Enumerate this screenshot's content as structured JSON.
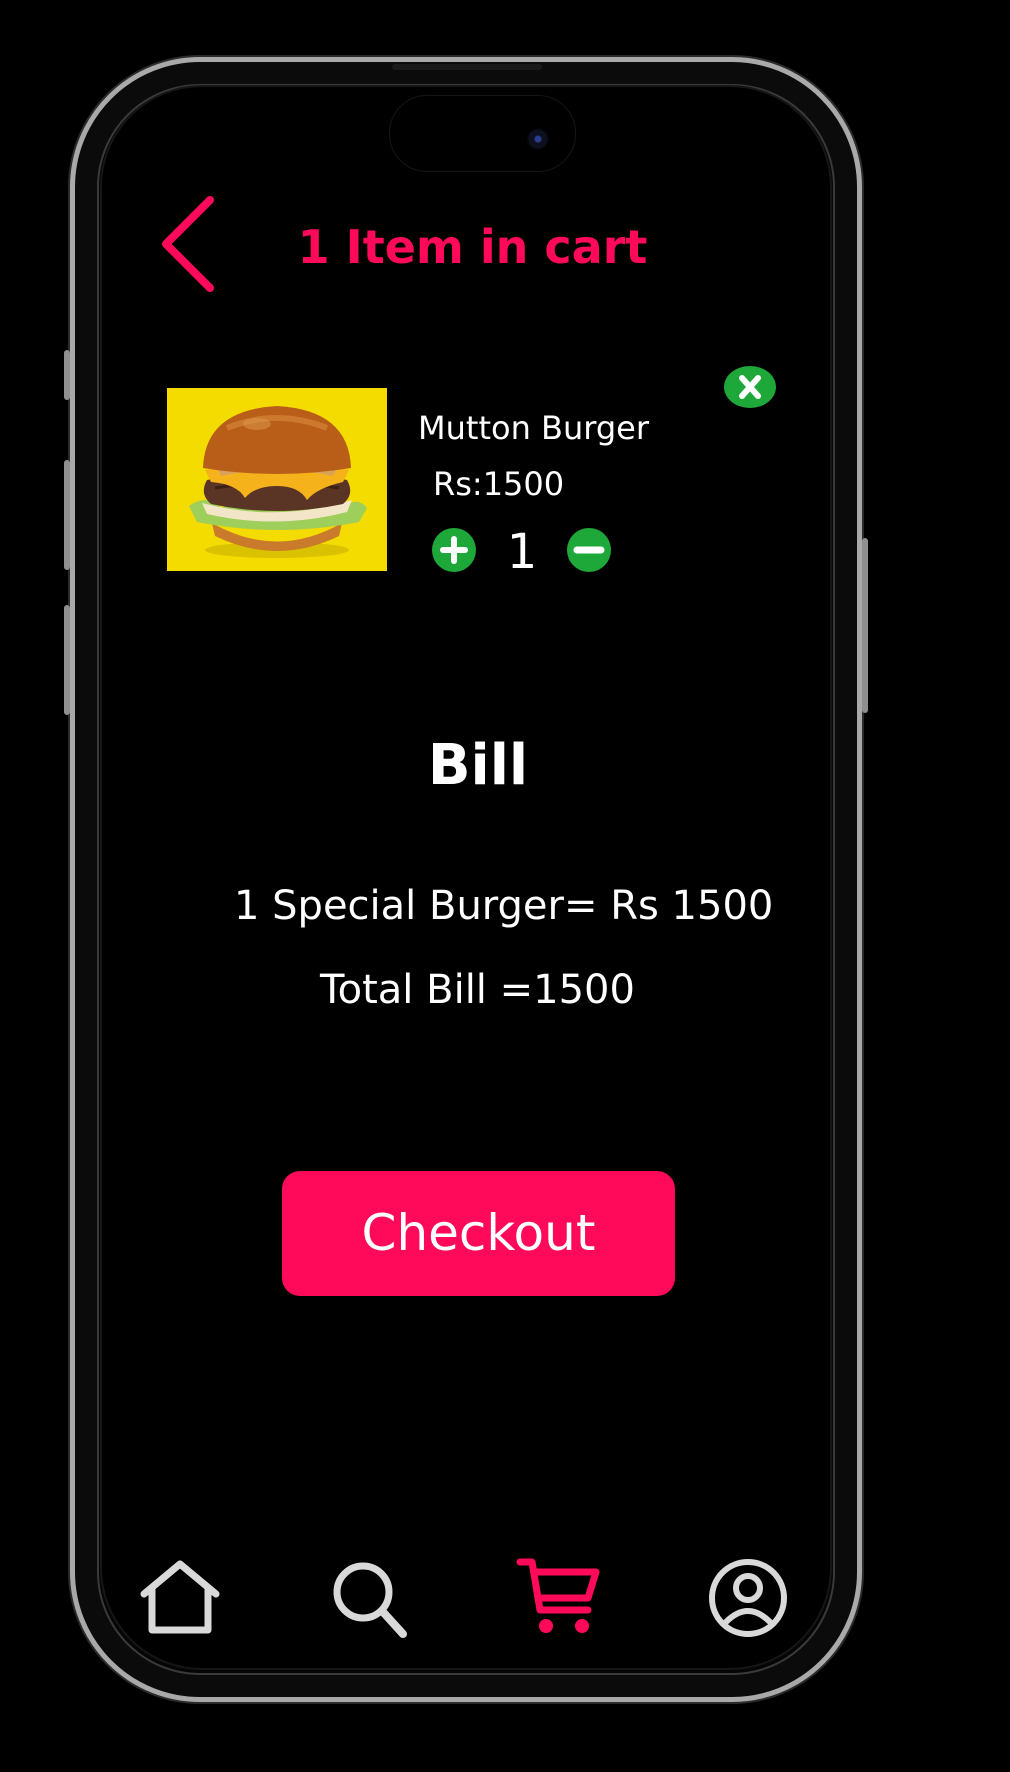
{
  "header": {
    "title": "1 Item in cart"
  },
  "cart_item": {
    "name": "Mutton Burger",
    "price": "Rs:1500",
    "quantity": "1"
  },
  "bill": {
    "heading": "Bill",
    "line_item": "1 Special Burger= Rs 1500",
    "total": "Total Bill =1500"
  },
  "checkout": {
    "label": "Checkout"
  },
  "nav": {
    "items": [
      {
        "icon": "home-icon"
      },
      {
        "icon": "search-icon"
      },
      {
        "icon": "cart-icon",
        "active": true
      },
      {
        "icon": "profile-icon"
      }
    ]
  },
  "colors": {
    "accent": "#ff0a5b",
    "action_green": "#1fa83a",
    "background": "#000000",
    "text": "#ffffff",
    "nav_inactive": "#d9d9d9"
  }
}
